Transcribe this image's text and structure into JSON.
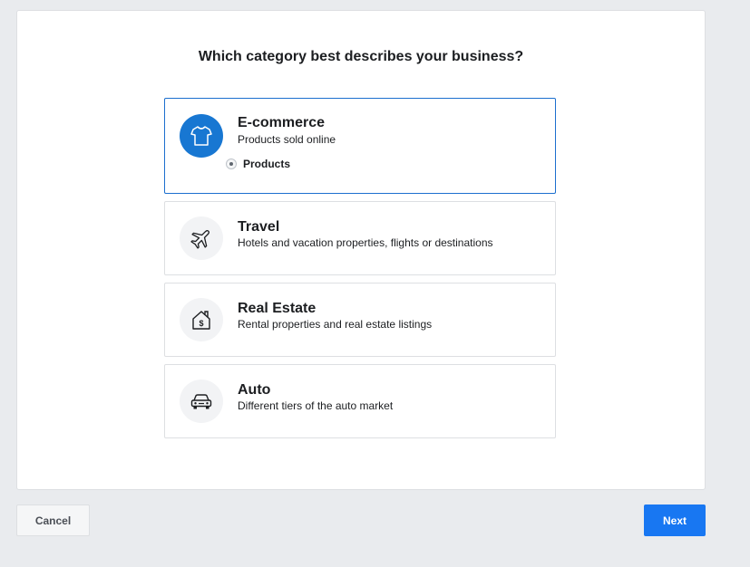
{
  "heading": "Which category best describes your business?",
  "categories": [
    {
      "title": "E-commerce",
      "subtitle": "Products sold online",
      "icon": "tshirt-icon",
      "selected": true,
      "option_label": "Products"
    },
    {
      "title": "Travel",
      "subtitle": "Hotels and vacation properties, flights or destinations",
      "icon": "airplane-icon",
      "selected": false
    },
    {
      "title": "Real Estate",
      "subtitle": "Rental properties and real estate listings",
      "icon": "house-dollar-icon",
      "selected": false
    },
    {
      "title": "Auto",
      "subtitle": "Different tiers of the auto market",
      "icon": "car-icon",
      "selected": false
    }
  ],
  "buttons": {
    "cancel_label": "Cancel",
    "next_label": "Next"
  },
  "colors": {
    "accent": "#1877f2",
    "selected_border": "#1c6fcf",
    "background": "#e9ebee"
  }
}
